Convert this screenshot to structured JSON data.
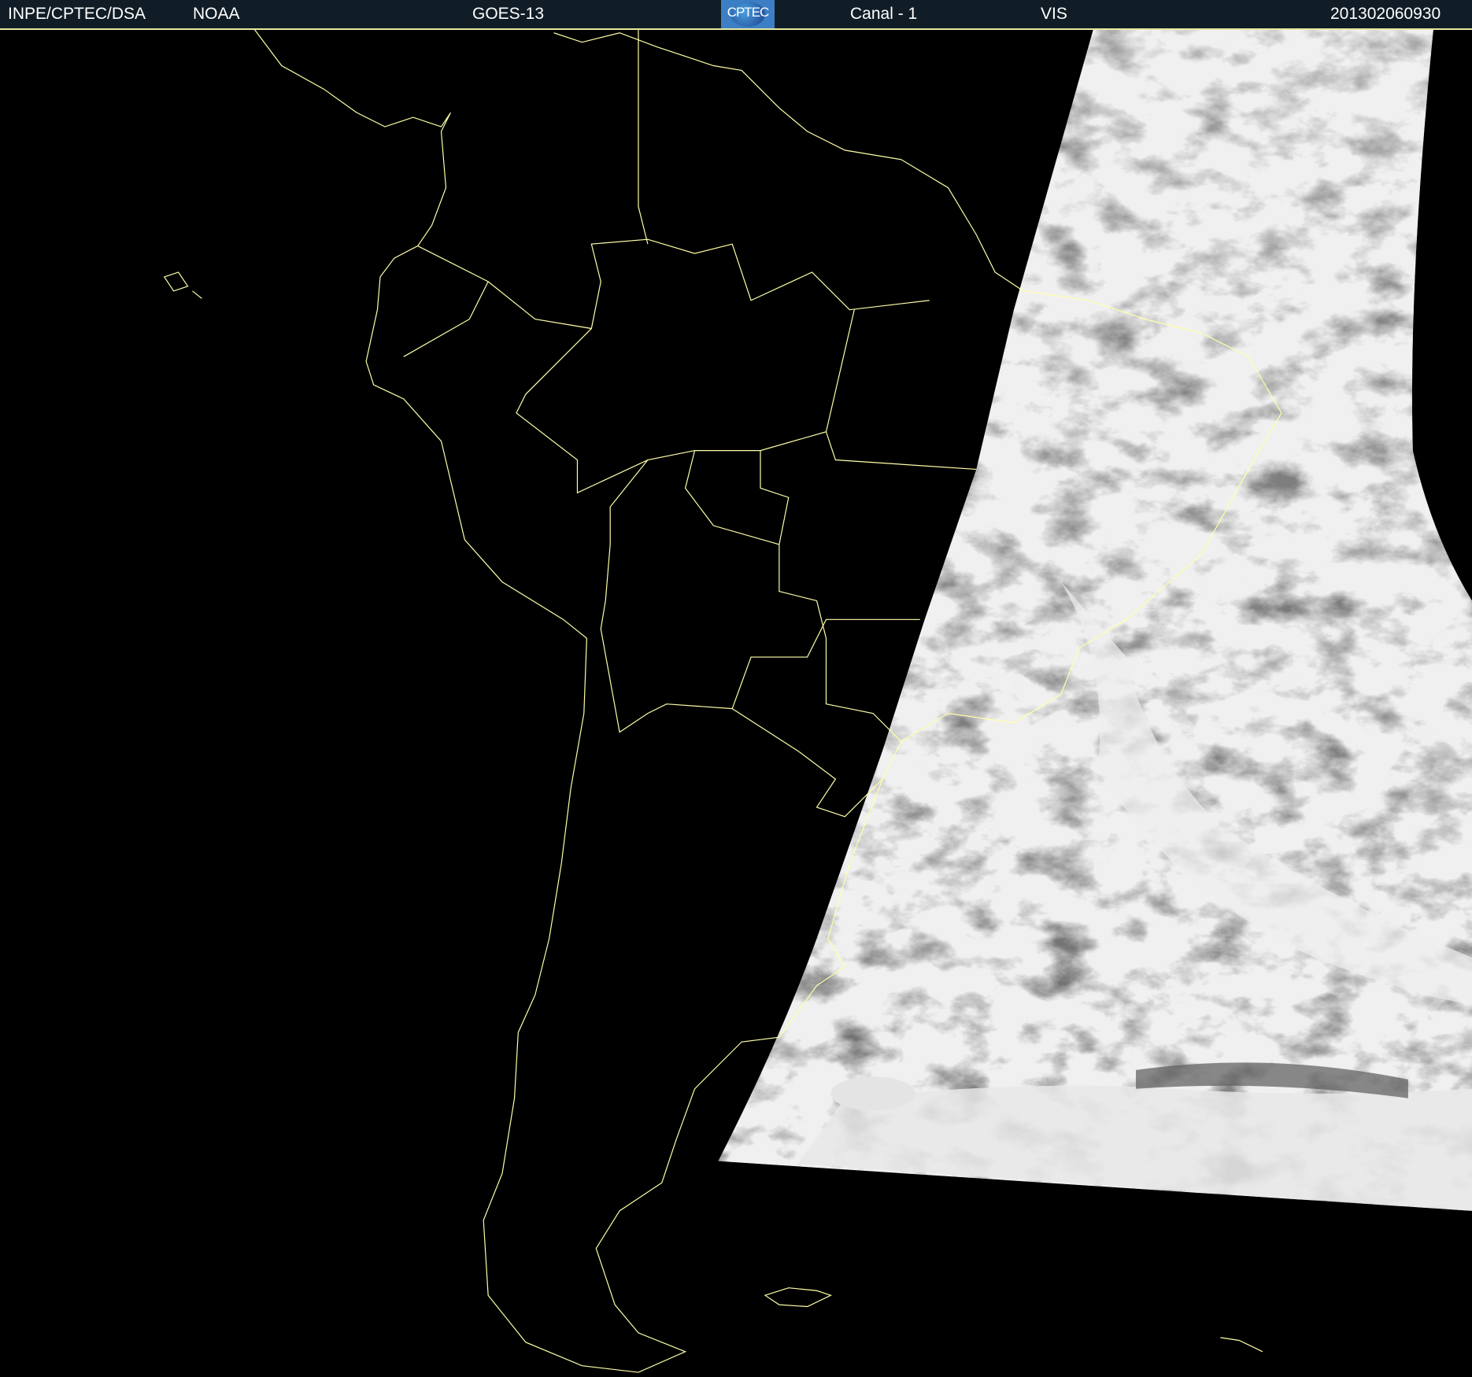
{
  "header": {
    "institution": "INPE/CPTEC/DSA",
    "agency": "NOAA",
    "satellite": "GOES-13",
    "logo_text": "CPTEC",
    "channel": "Canal - 1",
    "band": "VIS",
    "datetime": "201302060930"
  },
  "colors": {
    "header_bg": "#111d26",
    "coastline": "#ffffa8",
    "background": "#000000"
  }
}
